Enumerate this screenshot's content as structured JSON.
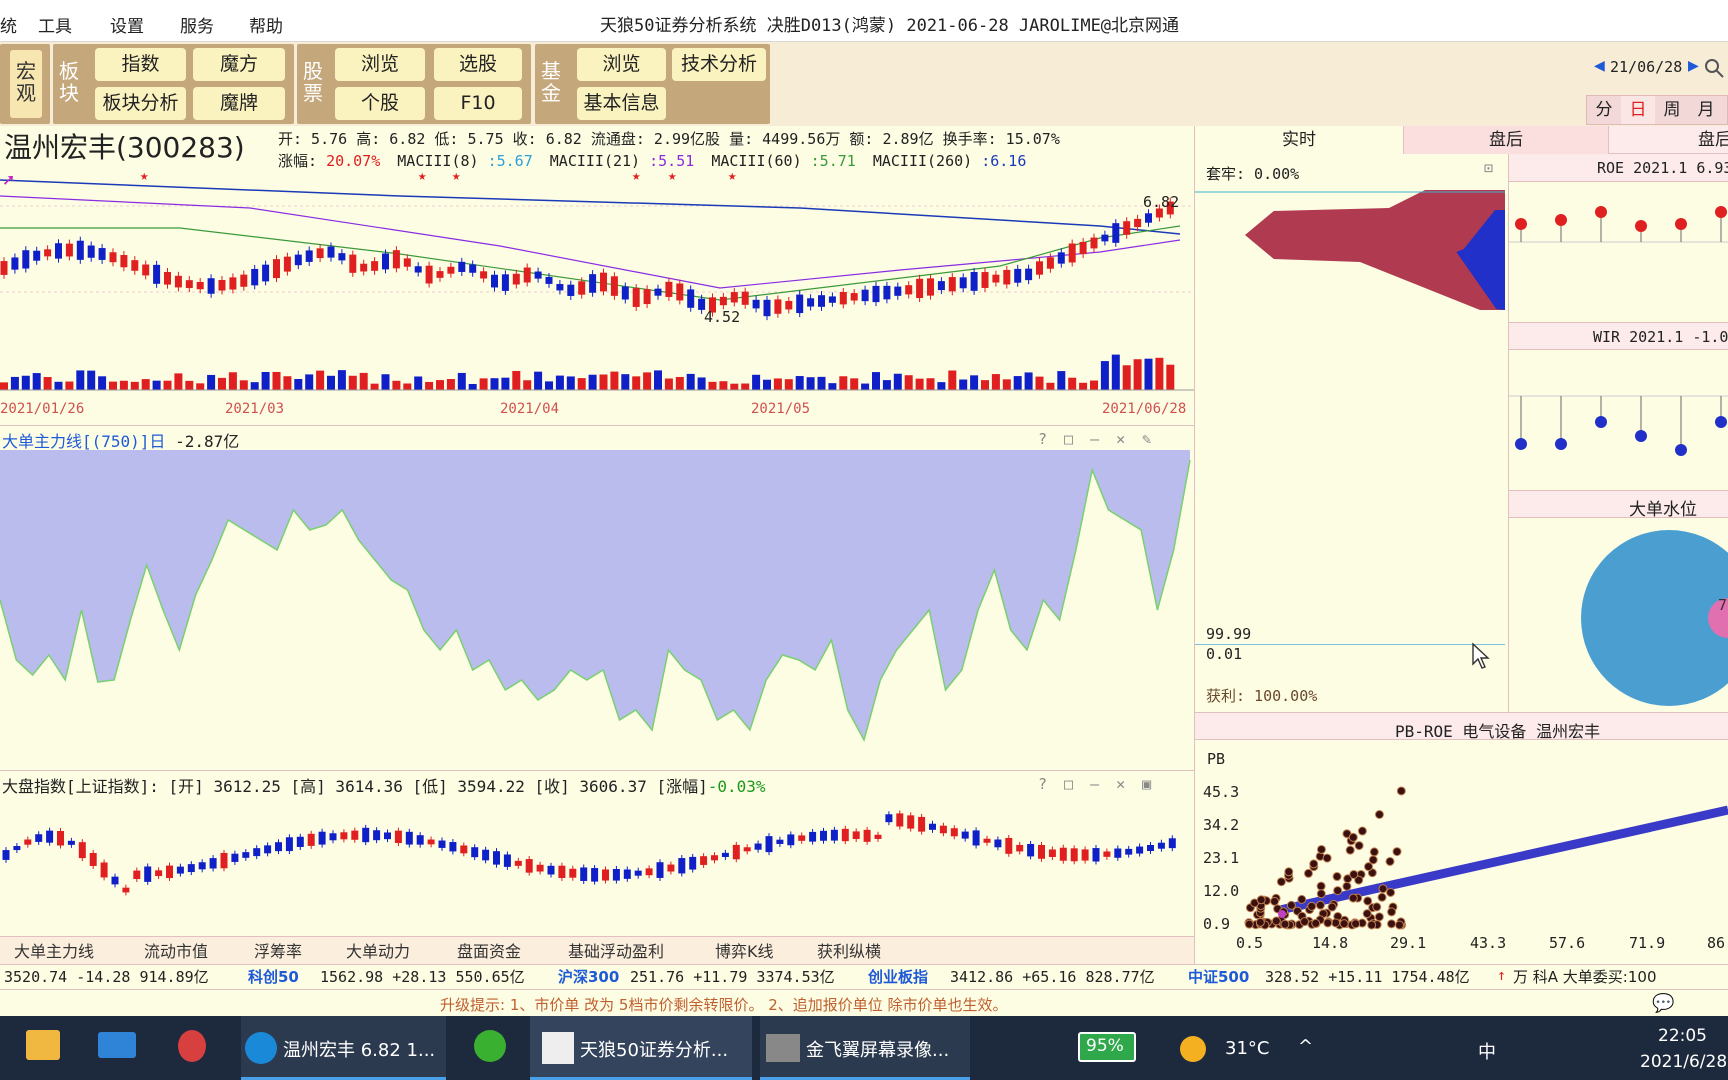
{
  "menu": {
    "item0": "统",
    "tools": "工具",
    "settings": "设置",
    "service": "服务",
    "help": "帮助"
  },
  "title": "天狼50证券分析系统  决胜D013(鸿蒙) 2021-06-28 JAROLIME@北京网通",
  "toolbar": {
    "macro": "宏观",
    "sector": "板块",
    "stock": "股票",
    "fund": "基金",
    "index": "指数",
    "cube": "魔方",
    "sector_analysis": "板块分析",
    "magic": "魔牌",
    "browse": "浏览",
    "pick": "选股",
    "single": "个股",
    "f10": "F10",
    "fund_browse": "浏览",
    "tech": "技术分析",
    "fund_info": "基本信息",
    "date_nav": "21/06/28",
    "periods": [
      "分",
      "日",
      "周",
      "月"
    ]
  },
  "stock": {
    "name": "温州宏丰(300283)",
    "info1": "开: 5.76 高: 6.82 低: 5.75 收: 6.82 流通盘: 2.99亿股 量: 4499.56万 额: 2.89亿 换手率: 15.07%",
    "change_label": "涨幅: ",
    "change": "20.07%",
    "ma1_label": "MACIII(8)",
    "ma1": ":5.67",
    "ma2_label": "MACIII(21)",
    "ma2": ":5.51",
    "ma3_label": "MACIII(60)",
    "ma3": ":5.71",
    "ma4_label": "MACIII(260)",
    "ma4": ":6.16",
    "high_label": "6.82",
    "low_label": "4.52",
    "dates": [
      "2021/01/26",
      "2021/03",
      "2021/04",
      "2021/05",
      "2021/06/28"
    ]
  },
  "indicator": {
    "title": "大单主力线[(750)]日",
    "value": "-2.87亿"
  },
  "market": {
    "title": "大盘指数[上证指数]:",
    "open": "[开] 3612.25",
    "high": "[高] 3614.36",
    "low": "[低] 3594.22",
    "close": "[收] 3606.37",
    "chg_label": "[涨幅]",
    "chg": "-0.03%"
  },
  "bottom_tabs": [
    "大单主力线",
    "流动市值",
    "浮筹率",
    "大单动力",
    "盘面资金",
    "基础浮动盈利",
    "博弈K线",
    "获利纵横"
  ],
  "ticker": {
    "t1": "3520.74  -14.28  914.89亿",
    "kc50": "科创50",
    "t2": "1562.98  +28.13  550.65亿",
    "hs300": "沪深300",
    "t3": "251.76  +11.79  3374.53亿",
    "cyb": "创业板指",
    "t4": "3412.86  +65.16  828.77亿",
    "zz500": "中证500",
    "t5": "328.52  +15.11  1754.48亿",
    "right": "万  科A  大单委买:100"
  },
  "hint": "升级提示: 1、市价单 改为 5档市价剩余转限价。 2、追加报价单位 除市价单也生效。",
  "right_tabs": [
    "实时",
    "盘后",
    "盘后"
  ],
  "chip": {
    "trap": "套牢: 0.00%",
    "v1": "99.99",
    "v2": "0.01",
    "profit": "获利: 100.00%"
  },
  "roe": {
    "title": "ROE 2021.1 6.93"
  },
  "wir": {
    "title": "WIR 2021.1 -1.0"
  },
  "water": {
    "title": "大单水位",
    "value": "7."
  },
  "pbroe": {
    "title": "PB-ROE  电气设备  温州宏丰",
    "ylabel": "PB",
    "yticks": [
      "45.3",
      "34.2",
      "23.1",
      "12.0",
      "0.9"
    ],
    "xticks": [
      "0.5",
      "14.8",
      "29.1",
      "43.3",
      "57.6",
      "71.9",
      "86"
    ]
  },
  "taskbar": {
    "app1": "温州宏丰 6.82 1...",
    "app2": "天狼50证券分析...",
    "app3": "金飞翼屏幕录像...",
    "battery": "95%",
    "temp": "31°C",
    "lang": "中",
    "time": "22:05",
    "date": "2021/6/28"
  }
}
